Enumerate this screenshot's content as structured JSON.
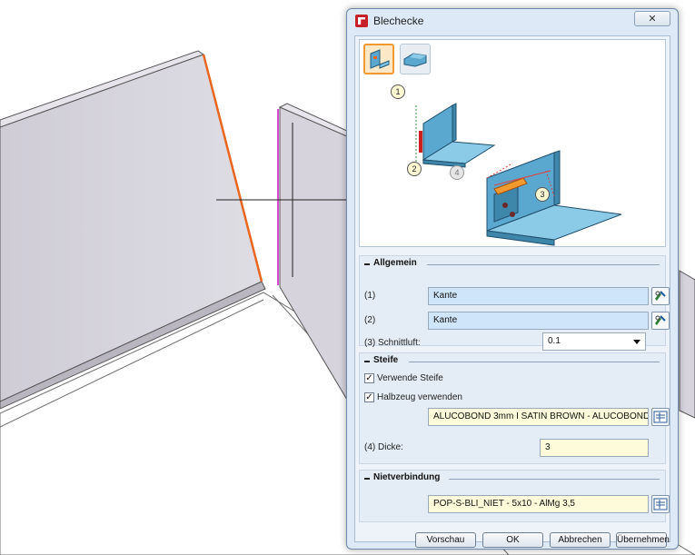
{
  "dialog": {
    "title": "Blechecke",
    "close_glyph": "✕"
  },
  "modes": [
    {
      "icon": "corner-miter-icon",
      "active": true
    },
    {
      "icon": "corner-relief-icon",
      "active": false
    }
  ],
  "illustration": {
    "markers": [
      "1",
      "2",
      "3",
      "4"
    ]
  },
  "allgemein": {
    "title": "Allgemein",
    "edge1_label": "(1)",
    "edge1_value": "Kante",
    "edge2_label": "(2)",
    "edge2_value": "Kante",
    "gap_label": "(3) Schnittluft:",
    "gap_value": "0.1"
  },
  "steife": {
    "title": "Steife",
    "use_stiffener_label": "Verwende Steife",
    "use_stiffener_checked": true,
    "use_semi_label": "Halbzeug verwenden",
    "use_semi_checked": true,
    "material_value": "ALUCOBOND 3mm I SATIN BROWN - ALUCOBOND",
    "thickness_label": "(4) Dicke:",
    "thickness_value": "3"
  },
  "niet": {
    "title": "Nietverbindung",
    "rivet_value": "POP-S-BLI_NIET -  5x10 - AlMg 3,5"
  },
  "buttons": {
    "preview": "Vorschau",
    "ok": "OK",
    "cancel": "Abbrechen",
    "apply": "Übernehmen"
  },
  "colors": {
    "accent": "#f29a2e",
    "edge_highlight_orange": "#e8661e",
    "edge_highlight_magenta": "#d64ad6",
    "field_blue": "#cfe5fa",
    "field_yellow": "#fdfbd9",
    "sheet_metal": "#5aa8d0"
  }
}
